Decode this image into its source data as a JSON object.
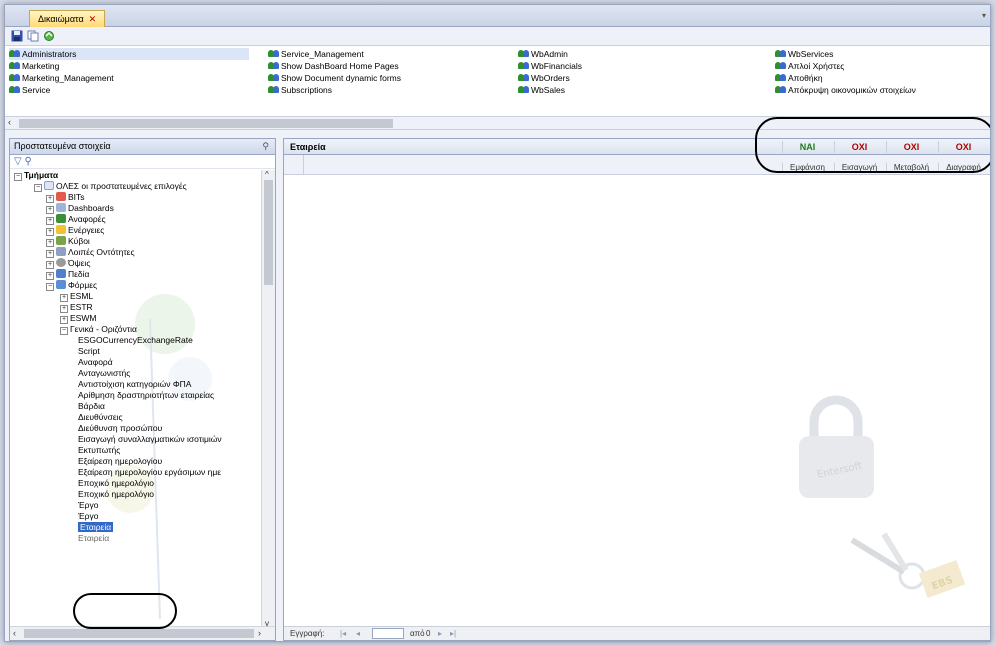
{
  "tab": {
    "label": "Δικαιώματα"
  },
  "roles": [
    [
      "Administrators",
      "Service_Management",
      "WbAdmin",
      "WbServices"
    ],
    [
      "Marketing",
      "Show DashBoard Home Pages",
      "WbFinancials",
      "Απλοί Χρήστες"
    ],
    [
      "Marketing_Management",
      "Show Document dynamic forms",
      "WbOrders",
      "Αποθήκη"
    ],
    [
      "Service",
      "Subscriptions",
      "WbSales",
      "Απόκρυψη οικονομικών στοιχείων"
    ]
  ],
  "left_panel": {
    "title": "Προστατευμένα στοιχεία",
    "tree": [
      {
        "label": "Τμήματα",
        "level": 0,
        "bold": true
      },
      {
        "label": "ΟΛΕΣ οι προστατευμένες επιλογές",
        "level": 1
      },
      {
        "label": "BITs",
        "level": 2
      },
      {
        "label": "Dashboards",
        "level": 2
      },
      {
        "label": "Αναφορές",
        "level": 2
      },
      {
        "label": "Ενέργειες",
        "level": 2
      },
      {
        "label": "Κύβοι",
        "level": 2
      },
      {
        "label": "Λοιπές Οντότητες",
        "level": 2
      },
      {
        "label": "Όψεις",
        "level": 2
      },
      {
        "label": "Πεδία",
        "level": 2
      },
      {
        "label": "Φόρμες",
        "level": 2
      },
      {
        "label": "ESML",
        "level": 3
      },
      {
        "label": "ESTR",
        "level": 3
      },
      {
        "label": "ESWM",
        "level": 3
      },
      {
        "label": "Γενικά - Οριζόντια",
        "level": 3
      },
      {
        "label": "ESGOCurrencyExchangeRate",
        "level": 4
      },
      {
        "label": "Script",
        "level": 4
      },
      {
        "label": "Αναφορά",
        "level": 4
      },
      {
        "label": "Ανταγωνιστής",
        "level": 4
      },
      {
        "label": "Αντιστοίχιση κατηγοριών ΦΠΑ",
        "level": 4
      },
      {
        "label": "Αρίθμηση δραστηριοτήτων εταιρείας",
        "level": 4
      },
      {
        "label": "Βάρδια",
        "level": 4
      },
      {
        "label": "Διευθύνσεις",
        "level": 4
      },
      {
        "label": "Διεύθυνση προσώπου",
        "level": 4
      },
      {
        "label": "Εισαγωγή συναλλαγματικών ισοτιμιών",
        "level": 4
      },
      {
        "label": "Εκτυπωτής",
        "level": 4
      },
      {
        "label": "Εξαίρεση ημερολογίου",
        "level": 4
      },
      {
        "label": "Εξαίρεση ημερολογίου εργάσιμων ημε",
        "level": 4
      },
      {
        "label": "Εποχικό ημερολόγιο",
        "level": 4
      },
      {
        "label": "Εποχικό ημερολόγιο",
        "level": 4
      },
      {
        "label": "Έργο",
        "level": 4
      },
      {
        "label": "Έργο",
        "level": 4
      },
      {
        "label": "Εταιρεία",
        "level": 4,
        "selected": true
      },
      {
        "label": "Εταιρεία",
        "level": 4
      }
    ]
  },
  "right_panel": {
    "title": "Εταιρεία",
    "permissions": [
      {
        "value": "NAI",
        "color": "#1f7a1f",
        "column": "Εμφάνιση"
      },
      {
        "value": "OXI",
        "color": "#b00000",
        "column": "Εισαγωγή"
      },
      {
        "value": "OXI",
        "color": "#b00000",
        "column": "Μεταβολή"
      },
      {
        "value": "OXI",
        "color": "#b00000",
        "column": "Διαγραφή"
      }
    ],
    "navigator": {
      "record_label": "Εγγραφή:",
      "of_label": "από",
      "total": "0"
    }
  }
}
